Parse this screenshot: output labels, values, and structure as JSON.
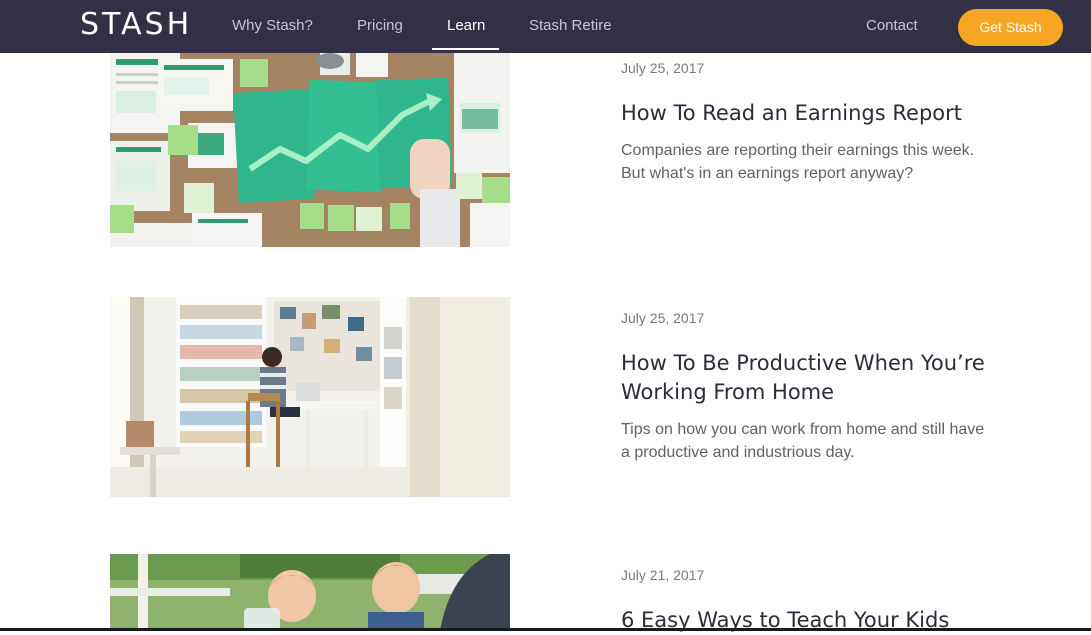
{
  "brand": {
    "logo": "STASH",
    "accent": "#f6a623",
    "nav_bg": "#332f44"
  },
  "nav": {
    "links": [
      "Why Stash?",
      "Pricing",
      "Learn",
      "Stash Retire"
    ],
    "active": "Learn",
    "contact": "Contact",
    "cta": "Get Stash"
  },
  "articles": [
    {
      "date": "July 25, 2017",
      "title": "How To Read an Earnings Report",
      "excerpt": "Companies are reporting their earnings this week. But what's in an earnings report anyway?"
    },
    {
      "date": "July 25, 2017",
      "title": "How To Be Productive When You’re Working From Home",
      "excerpt": "Tips on how you can work from home and still have a productive and industrious day."
    },
    {
      "date": "July 21, 2017",
      "title": "6 Easy Ways to Teach Your Kids",
      "excerpt": ""
    }
  ]
}
